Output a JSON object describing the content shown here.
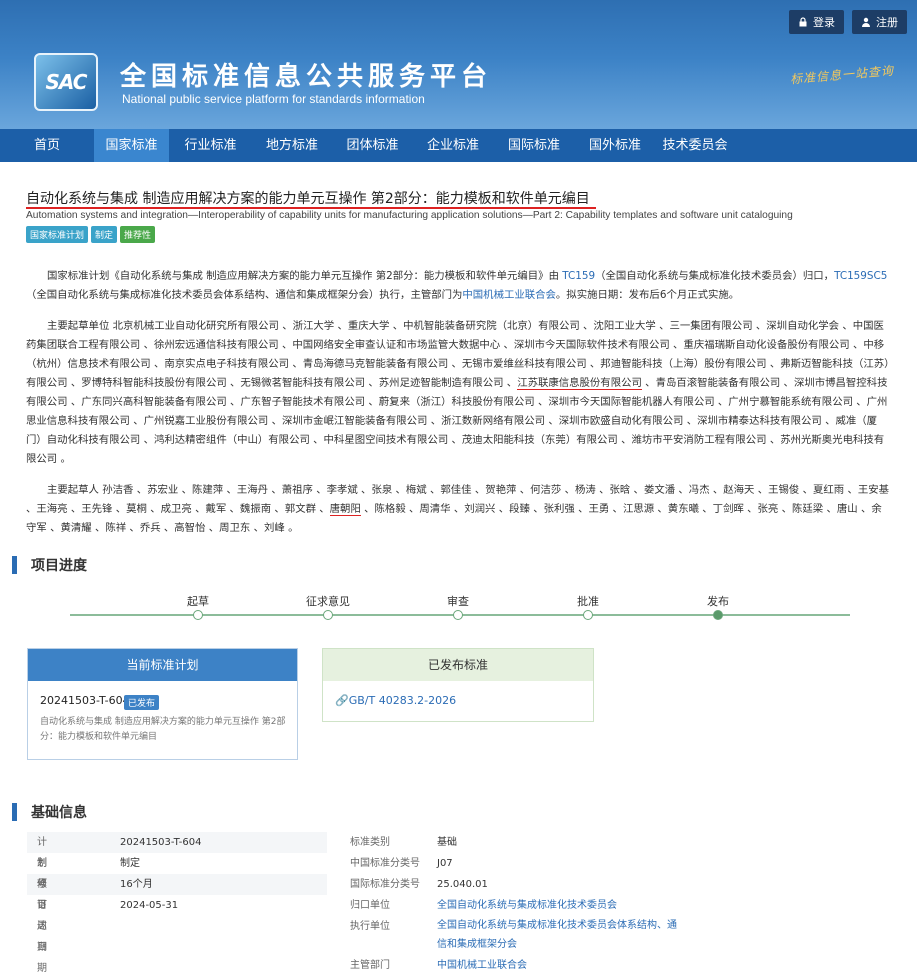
{
  "header": {
    "login": "登录",
    "register": "注册",
    "logo_text": "SAC",
    "site_title": "全国标准信息公共服务平台",
    "site_subtitle": "National public service platform  for standards information",
    "slogan": "标准信息一站查询"
  },
  "nav": {
    "items": [
      "首页",
      "国家标准",
      "行业标准",
      "地方标准",
      "团体标准",
      "企业标准",
      "国际标准",
      "国外标准",
      "技术委员会"
    ],
    "active_index": 1
  },
  "standard": {
    "title": "自动化系统与集成 制造应用解决方案的能力单元互操作 第2部分：能力模板和软件单元编目",
    "english_title": "Automation systems and integration—Interoperability of capability units for manufacturing application solutions—Part 2: Capability templates and software unit cataloguing",
    "tags": [
      {
        "label": "国家标准计划",
        "color": "#3aa3c9"
      },
      {
        "label": "制定",
        "color": "#3aa3c9"
      },
      {
        "label": "推荐性",
        "color": "#4aa84a"
      }
    ],
    "intro": {
      "p1": "国家标准计划《自动化系统与集成 制造应用解决方案的能力单元互操作 第2部分：能力模板和软件单元编目》由 ",
      "p1_link1": "TC159",
      "p1_b": "（全国自动化系统与集成标准化技术委员会）归口，",
      "p1_link2": "TC159SC5",
      "p1_c": "（全国自动化系统与集成标准化技术委员会体系结构、通信和集成框架分会）执行，主管部门为",
      "p1_link3": "中国机械工业联合会",
      "p1_d": "。拟实施日期：发布后6个月正式实施。"
    },
    "drafting_units_a": "主要起草单位 北京机械工业自动化研究所有限公司 、浙江大学 、重庆大学 、中机智能装备研究院（北京）有限公司 、沈阳工业大学 、三一集团有限公司 、深圳自动化学会 、中国医药集团联合工程有限公司 、徐州宏远通信科技有限公司 、中国网络安全审查认证和市场监管大数据中心 、深圳市今天国际软件技术有限公司 、重庆福瑞斯自动化设备股份有限公司 、中移（杭州）信息技术有限公司 、南京实点电子科技有限公司 、青岛海德马克智能装备有限公司 、无锡市爱维丝科技有限公司 、邦迪智能科技（上海）股份有限公司 、弗斯迈智能科技（江苏）有限公司 、罗博特科智能科技股份有限公司 、无锡微茗智能科技有限公司 、苏州足迹智能制造有限公司 、",
    "drafting_units_highlight": "江苏联康信息股份有限公司",
    "drafting_units_b": " 、青岛百滚智能装备有限公司 、深圳市博昌智控科技有限公司 、广东同兴高科智能装备有限公司 、广东智子智能技术有限公司 、蔚复来（浙江）科技股份有限公司 、深圳市今天国际智能机器人有限公司 、广州宁慕智能系统有限公司 、广州思业信息科技有限公司 、广州锐嘉工业股份有限公司 、深圳市金岷江智能装备有限公司 、浙江数新网络有限公司 、深圳市欧盛自动化有限公司 、深圳市精泰达科技有限公司 、威准（厦门）自动化科技有限公司 、鸿利达精密组件（中山）有限公司 、中科星图空间技术有限公司 、茂迪太阳能科技（东莞）有限公司 、潍坊市平安消防工程有限公司 、苏州光斯奥光电科技有限公司 。",
    "drafters_a": "主要起草人 孙洁香 、苏宏业 、陈建萍 、王海丹 、萧祖序 、李孝斌 、张泉 、梅斌 、郭佳佳 、贺艳萍 、何洁莎 、杨涛 、张晗 、娄文潘 、冯杰 、赵海天 、王锡俊 、夏红雨 、王安基 、王海亮 、王先锋 、莫桐 、成卫亮 、戴军 、魏振南 、郭文群 、",
    "drafters_highlight": "唐朝阳",
    "drafters_b": " 、陈格毅 、周清华 、刘润兴 、段臻 、张利强 、王勇 、江思源 、黄东曦 、丁剑晖 、张亮 、陈廷梁 、唐山 、余守军 、黄清耀 、陈祥 、乔兵 、高智怡 、周卫东 、刘峰 。"
  },
  "progress": {
    "heading": "项目进度",
    "steps": [
      "起草",
      "征求意见",
      "审查",
      "批准",
      "发布"
    ],
    "current_index": 4
  },
  "plan_card": {
    "heading": "当前标准计划",
    "plan_no": "20241503-T-604",
    "badge": "已发布",
    "desc": "自动化系统与集成 制造应用解决方案的能力单元互操作 第2部分：能力模板和软件单元编目"
  },
  "published_card": {
    "heading": "已发布标准",
    "std_link": "GB/T 40283.2-2026"
  },
  "basic_info": {
    "heading": "基础信息",
    "left": [
      {
        "label": "计划号",
        "value": "20241503-T-604"
      },
      {
        "label": "制修订",
        "value": "制定"
      },
      {
        "label": "项目周期",
        "value": "16个月"
      },
      {
        "label": "下达日期",
        "value": "2024-05-31"
      }
    ],
    "right": [
      {
        "label": "标准类别",
        "value": "基础"
      },
      {
        "label": "中国标准分类号",
        "value": "J07"
      },
      {
        "label": "国际标准分类号",
        "value": "25.040.01"
      },
      {
        "label": "归口单位",
        "value": "全国自动化系统与集成标准化技术委员会"
      },
      {
        "label": "执行单位",
        "value": "全国自动化系统与集成标准化技术委员会体系结构、通信和集成框架分会"
      },
      {
        "label": "主管部门",
        "value": "中国机械工业联合会"
      }
    ]
  }
}
